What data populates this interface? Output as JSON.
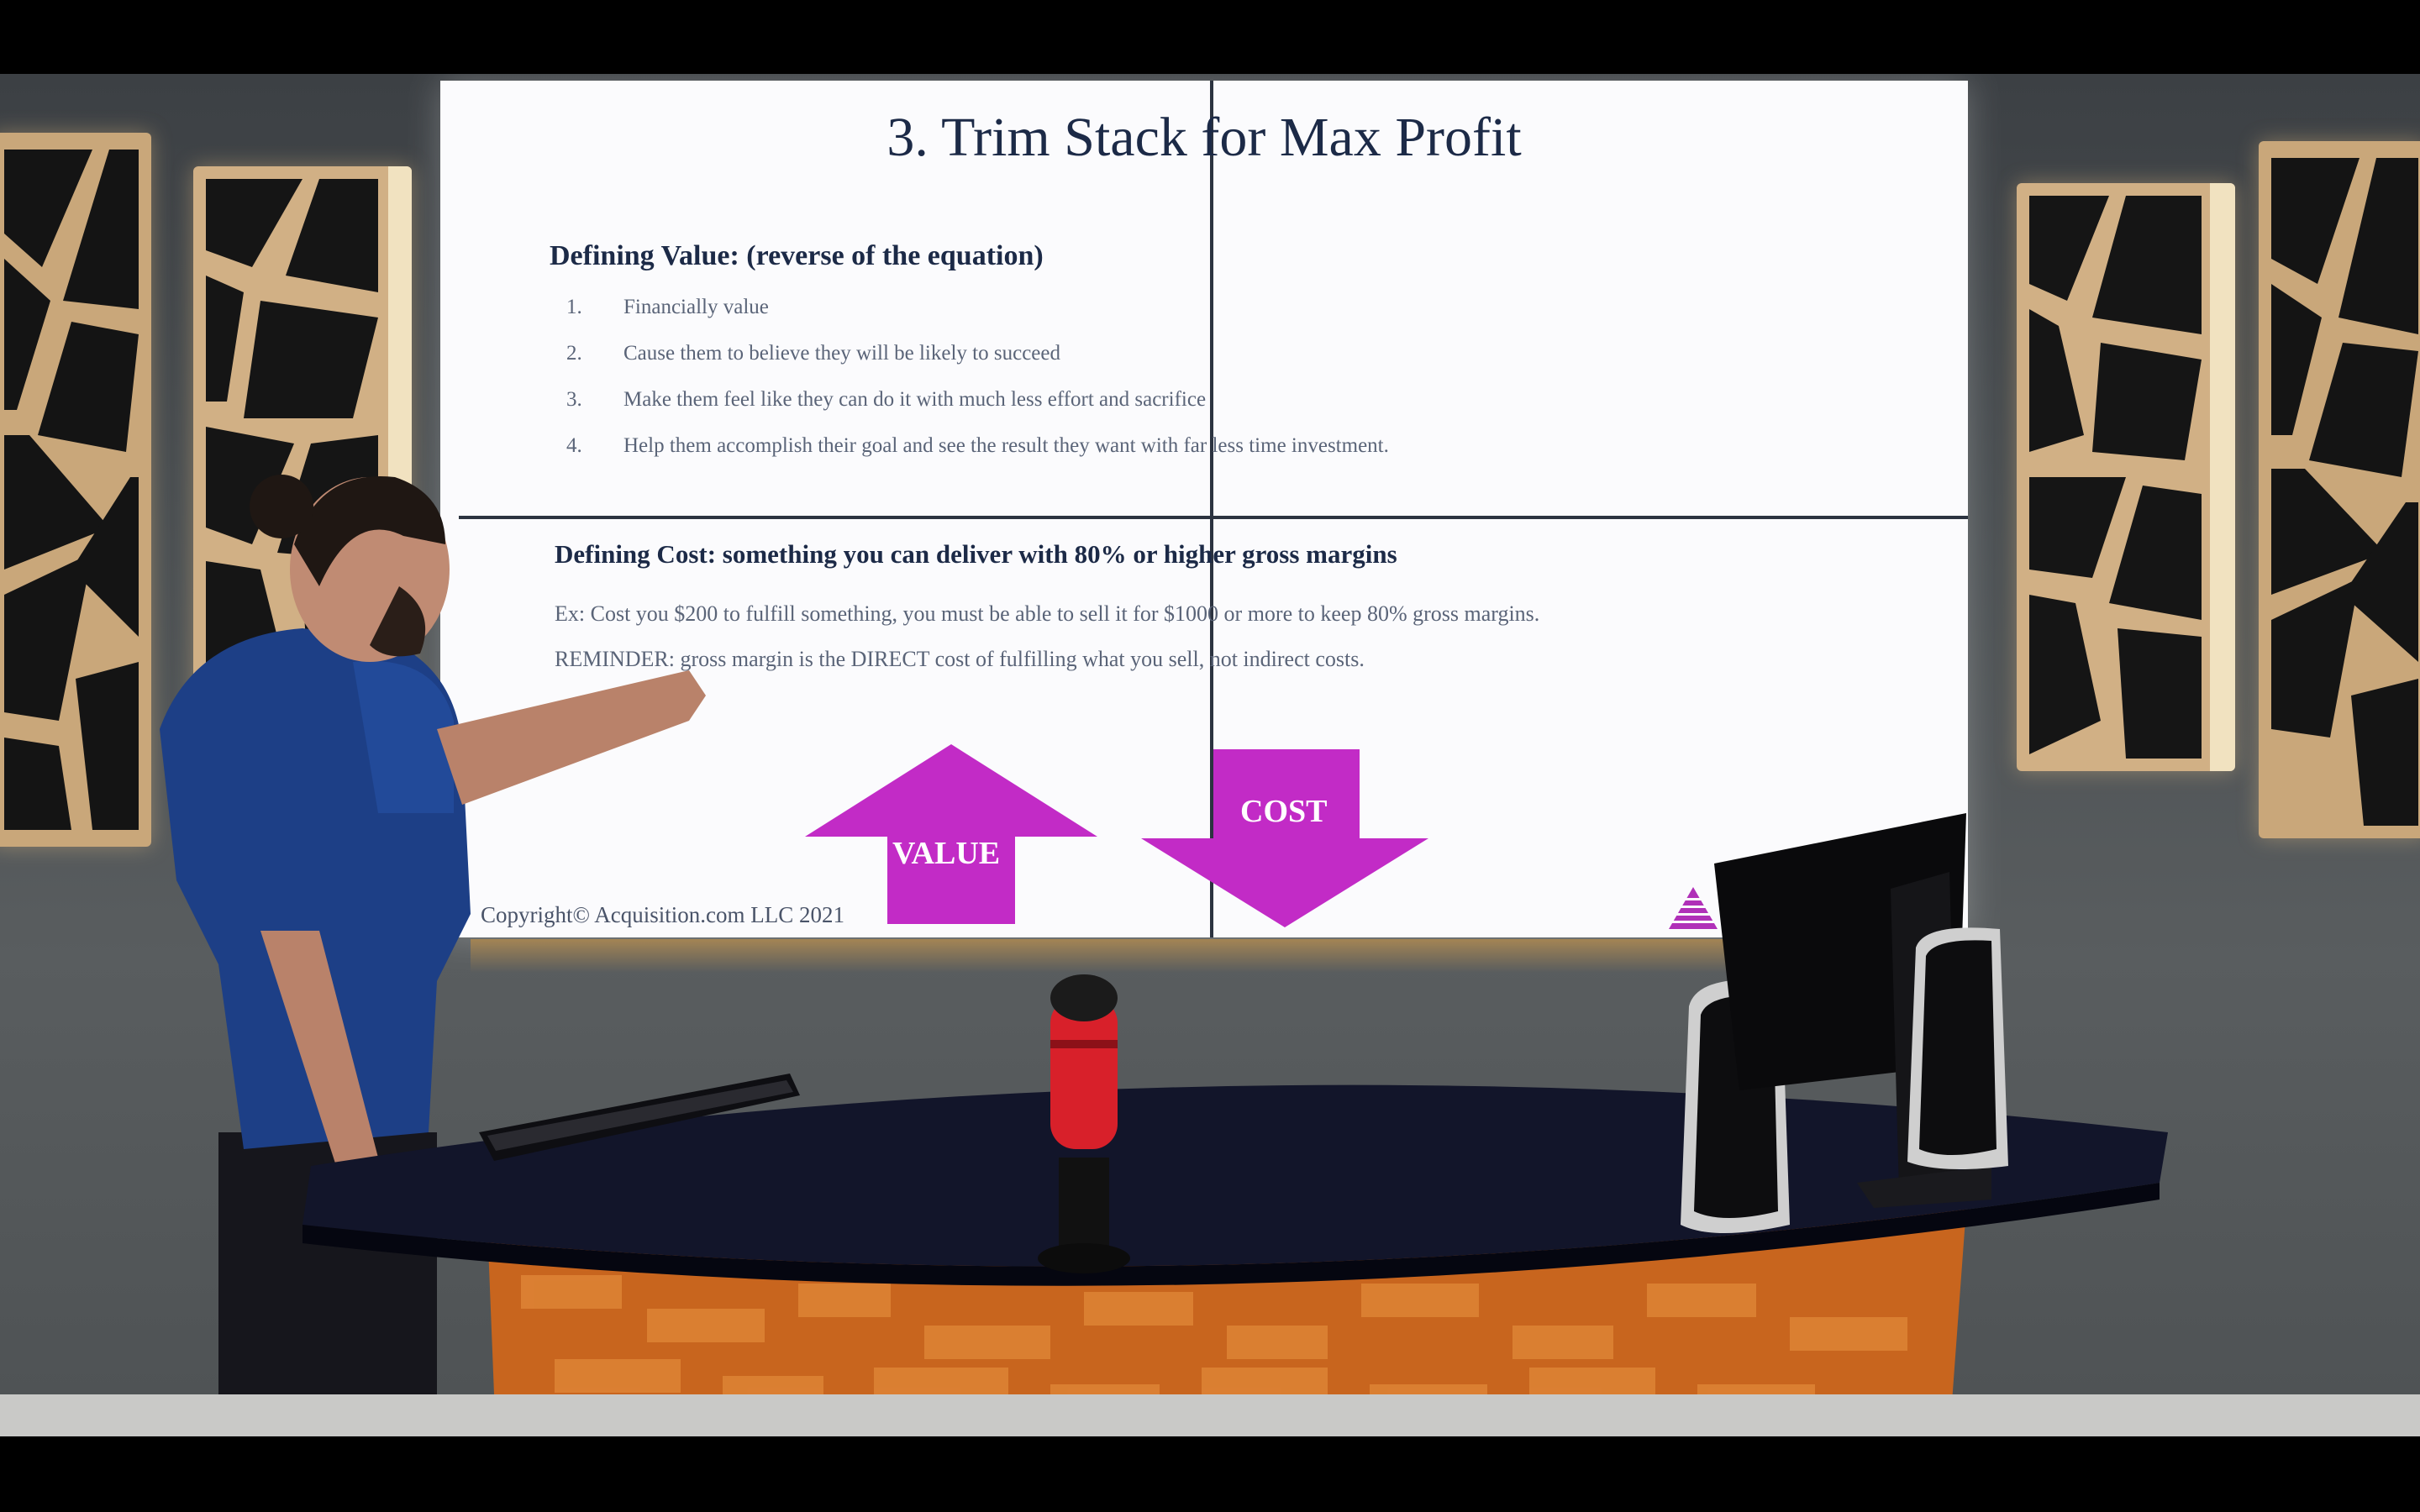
{
  "slide": {
    "title": "3. Trim  Stack for Max Profit",
    "value_heading": "Defining Value: (reverse of the equation)",
    "value_items": [
      {
        "num": "1.",
        "text": "Financially value"
      },
      {
        "num": "2.",
        "text": "Cause them to believe they will be likely to succeed"
      },
      {
        "num": "3.",
        "text": "Make them feel like they can do it with much less effort and sacrifice"
      },
      {
        "num": "4.",
        "text": "Help them accomplish their goal and see the result they want with far less time investment."
      }
    ],
    "cost_heading": "Defining Cost: something you can deliver with 80% or higher gross margins",
    "cost_example": "Ex: Cost you $200 to fulfill something, you must be able to sell it for $1000 or more to keep 80% gross margins. REMINDER: gross margin is the DIRECT cost of fulfilling what you sell, not indirect costs.",
    "value_arrow_label": "VALUE",
    "cost_arrow_label": "COST",
    "copyright": "Copyright© Acquisition.com LLC 2021"
  },
  "colors": {
    "arrow": "#c22bc6",
    "title": "#1c2a47",
    "body_text": "#5a6478",
    "microphone": "#d8202a",
    "desk_top": "#12152a",
    "desk_front": "#c8651e"
  },
  "icons": {
    "logo": "purple-striped-triangle-icon"
  }
}
